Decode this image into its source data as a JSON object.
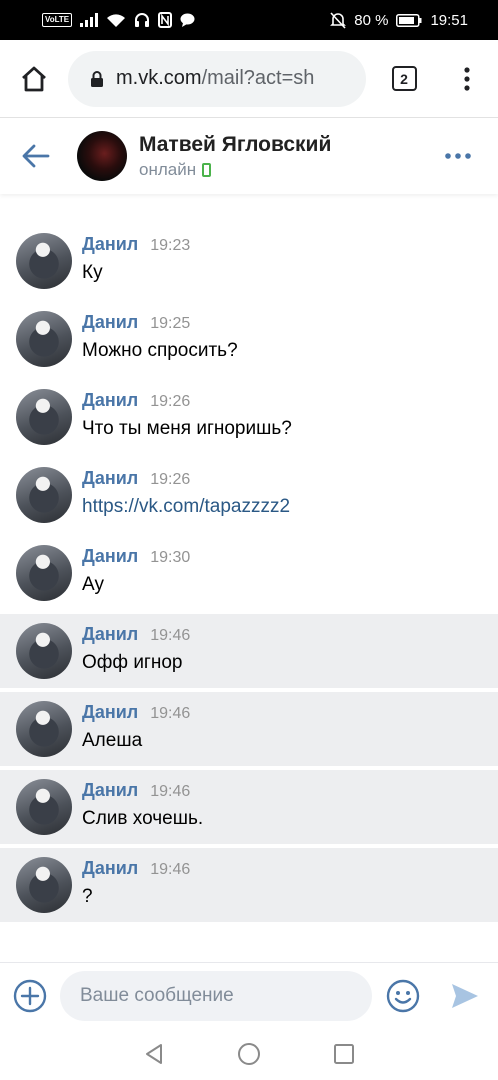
{
  "status_bar": {
    "volte": "VoLTE",
    "battery": "80 %",
    "time": "19:51"
  },
  "browser": {
    "url_host": "m.vk.com",
    "url_path": "/mail?act=sh",
    "tab_count": "2"
  },
  "chat_header": {
    "name": "Матвей Ягловский",
    "status": "онлайн"
  },
  "messages": [
    {
      "author": "Данил",
      "time": "19:23",
      "text": "Ку",
      "unread": false,
      "link": false
    },
    {
      "author": "Данил",
      "time": "19:25",
      "text": "Можно спросить?",
      "unread": false,
      "link": false
    },
    {
      "author": "Данил",
      "time": "19:26",
      "text": "Что ты меня игноришь?",
      "unread": false,
      "link": false
    },
    {
      "author": "Данил",
      "time": "19:26",
      "text": "https://vk.com/tapazzzz2",
      "unread": false,
      "link": true
    },
    {
      "author": "Данил",
      "time": "19:30",
      "text": "Ау",
      "unread": false,
      "link": false
    },
    {
      "author": "Данил",
      "time": "19:46",
      "text": "Офф игнор",
      "unread": true,
      "link": false
    },
    {
      "author": "Данил",
      "time": "19:46",
      "text": "Алеша",
      "unread": true,
      "link": false
    },
    {
      "author": "Данил",
      "time": "19:46",
      "text": "Слив хочешь.",
      "unread": true,
      "link": false
    },
    {
      "author": "Данил",
      "time": "19:46",
      "text": "?",
      "unread": true,
      "link": false
    }
  ],
  "composer": {
    "placeholder": "Ваше сообщение"
  },
  "colors": {
    "accent": "#4a76a8",
    "unread_bg": "#edeef0",
    "online": "#4bb34b"
  }
}
